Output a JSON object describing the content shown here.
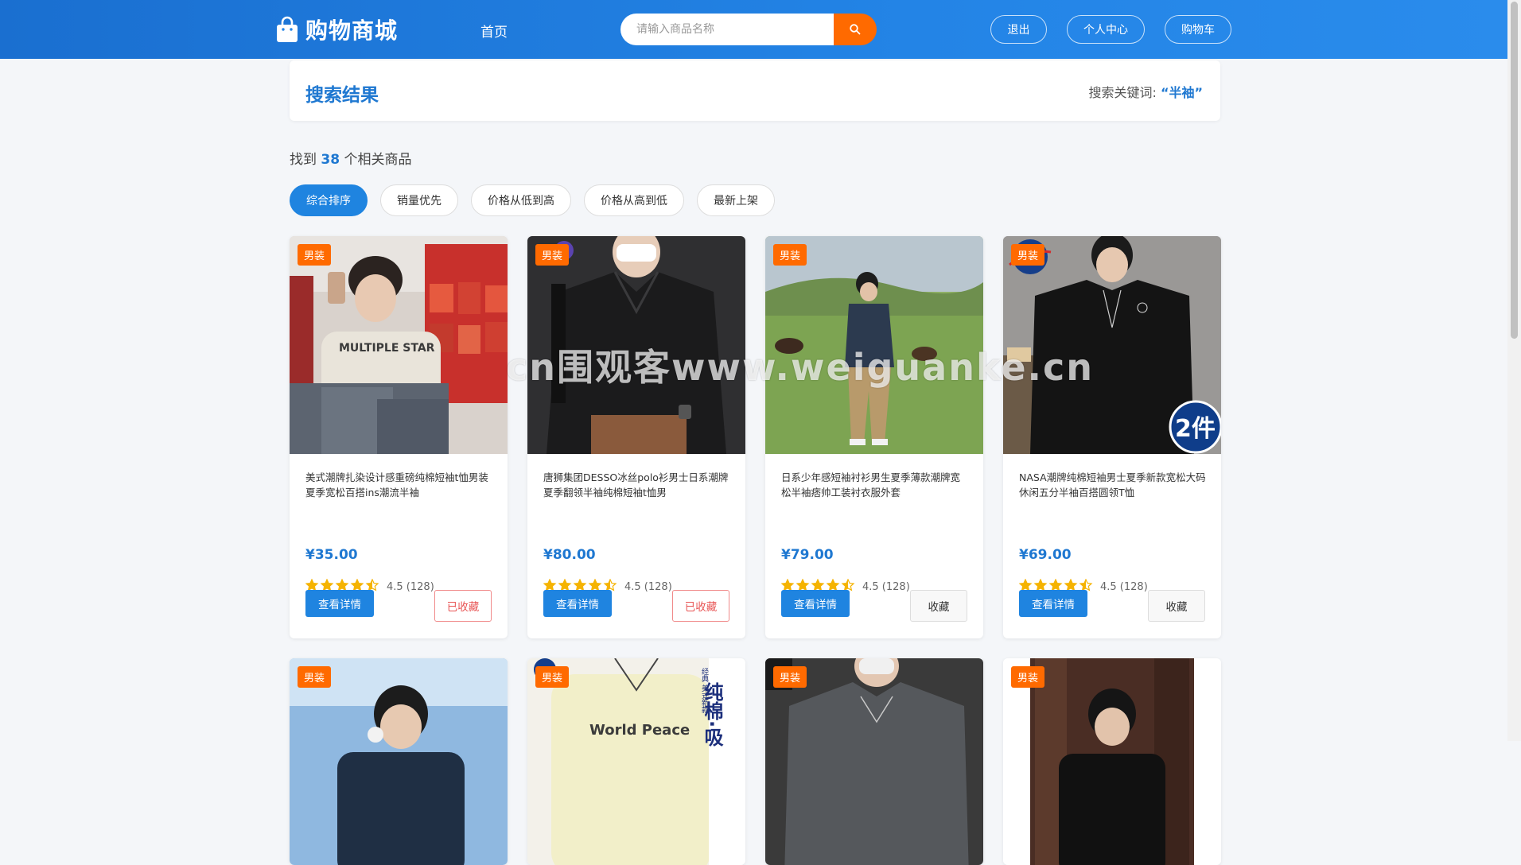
{
  "header": {
    "logo_text": "购物商城",
    "nav_home": "首页",
    "search_placeholder": "请输入商品名称",
    "logout": "退出",
    "profile": "个人中心",
    "cart": "购物车"
  },
  "result": {
    "title": "搜索结果",
    "keyword_label": "搜索关键词:",
    "keyword": "“半袖”",
    "found_prefix": "找到",
    "found_count": "38",
    "found_suffix": "个相关商品"
  },
  "sorts": [
    {
      "label": "综合排序",
      "active": true
    },
    {
      "label": "销量优先",
      "active": false
    },
    {
      "label": "价格从低到高",
      "active": false
    },
    {
      "label": "价格从高到低",
      "active": false
    },
    {
      "label": "最新上架",
      "active": false
    }
  ],
  "products": [
    {
      "tag": "男装",
      "name": "美式潮牌扎染设计感重磅纯棉短袖t恤男装夏季宽松百搭ins潮流半袖",
      "price": "¥35.00",
      "rating": 4.5,
      "rating_text": "4.5 (128)",
      "detail_label": "查看详情",
      "fav_label": "已收藏",
      "faved": true
    },
    {
      "tag": "男装",
      "name": "唐狮集团DESSO冰丝polo衫男士日系潮牌夏季翻领半袖纯棉短袖t恤男",
      "price": "¥80.00",
      "rating": 4.5,
      "rating_text": "4.5 (128)",
      "detail_label": "查看详情",
      "fav_label": "已收藏",
      "faved": true
    },
    {
      "tag": "男装",
      "name": "日系少年感短袖衬衫男生夏季薄款潮牌宽松半袖痞帅工装衬衣服外套",
      "price": "¥79.00",
      "rating": 4.5,
      "rating_text": "4.5 (128)",
      "detail_label": "查看详情",
      "fav_label": "收藏",
      "faved": false
    },
    {
      "tag": "男装",
      "name": "NASA潮牌纯棉短袖男士夏季新款宽松大码休闲五分半袖百搭圆领T恤",
      "price": "¥69.00",
      "rating": 4.5,
      "rating_text": "4.5 (128)",
      "detail_label": "查看详情",
      "fav_label": "收藏",
      "faved": false
    },
    {
      "tag": "男装"
    },
    {
      "tag": "男装"
    },
    {
      "tag": "男装"
    },
    {
      "tag": "男装"
    }
  ],
  "images": {
    "p2_badge": "团",
    "p4_sticker": "2件",
    "p6_title": "World Peace",
    "p6_side": "纯棉·吸",
    "p6_side_small": "经典 美式新款"
  },
  "watermark": "cn围观客www.weiguanke.cn",
  "colors": {
    "header": "#1f78d6",
    "accent": "#1f84e0",
    "tag": "#ff6a00",
    "star": "#f5b301",
    "fav_red": "#e85454"
  }
}
